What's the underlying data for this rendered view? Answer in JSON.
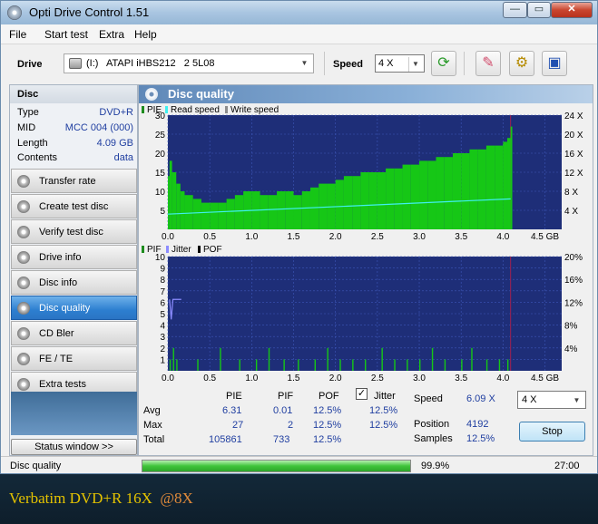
{
  "window": {
    "title": "Opti Drive Control 1.51",
    "min": "—",
    "max": "▭",
    "close": "✕"
  },
  "menu": [
    "File",
    "Start test",
    "Extra",
    "Help"
  ],
  "toolbar": {
    "drive_label": "Drive",
    "drive_value": "(I:)   ATAPI iHBS212   2 5L08",
    "speed_label": "Speed",
    "speed_value": "4 X",
    "icons": [
      "refresh-icon",
      "eraser-icon",
      "settings-icon",
      "save-icon"
    ]
  },
  "disc_info": {
    "header": "Disc",
    "rows": [
      {
        "key": "Type",
        "value": "DVD+R"
      },
      {
        "key": "MID",
        "value": "MCC 004 (000)"
      },
      {
        "key": "Length",
        "value": "4.09 GB"
      },
      {
        "key": "Contents",
        "value": "data"
      }
    ]
  },
  "nav": [
    {
      "label": "Transfer rate",
      "active": false
    },
    {
      "label": "Create test disc",
      "active": false
    },
    {
      "label": "Verify test disc",
      "active": false
    },
    {
      "label": "Drive info",
      "active": false
    },
    {
      "label": "Disc info",
      "active": false
    },
    {
      "label": "Disc quality",
      "active": true
    },
    {
      "label": "CD Bler",
      "active": false
    },
    {
      "label": "FE / TE",
      "active": false
    },
    {
      "label": "Extra tests",
      "active": false
    }
  ],
  "status_window_button": "Status window >>",
  "main": {
    "title": "Disc quality"
  },
  "chart_data": [
    {
      "type": "area",
      "legend": [
        {
          "name": "PIE",
          "color": "#1e8c1e"
        },
        {
          "name": "Read speed",
          "color": "#3ff0f0"
        },
        {
          "name": "Write speed",
          "color": "#8c8c8c"
        }
      ],
      "x_ticks": [
        "0.0",
        "0.5",
        "1.0",
        "1.5",
        "2.0",
        "2.5",
        "3.0",
        "3.5",
        "4.0",
        "4.5 GB"
      ],
      "y_ticks": [
        "30",
        "25",
        "20",
        "15",
        "10",
        "5"
      ],
      "y2_ticks": [
        "24 X",
        "20 X",
        "16 X",
        "12 X",
        "8 X",
        "4 X"
      ],
      "xlim": [
        0,
        4.7
      ],
      "ylim": [
        0,
        30
      ],
      "y2lim": [
        0,
        24
      ],
      "background": "#1e2e78",
      "grid": true,
      "series": [
        {
          "name": "PIE",
          "x": [
            0.0,
            0.02,
            0.05,
            0.1,
            0.15,
            0.2,
            0.3,
            0.4,
            0.5,
            0.6,
            0.7,
            0.8,
            0.9,
            1.0,
            1.1,
            1.2,
            1.3,
            1.4,
            1.5,
            1.6,
            1.7,
            1.8,
            1.9,
            2.0,
            2.1,
            2.2,
            2.3,
            2.4,
            2.5,
            2.6,
            2.7,
            2.8,
            2.9,
            3.0,
            3.1,
            3.2,
            3.3,
            3.4,
            3.5,
            3.6,
            3.7,
            3.8,
            3.9,
            4.0,
            4.05,
            4.09
          ],
          "values": [
            14,
            18,
            15,
            12,
            10,
            9,
            8,
            7,
            7,
            7,
            8,
            9,
            10,
            10,
            9,
            9,
            10,
            10,
            9,
            10,
            11,
            12,
            12,
            13,
            14,
            14,
            15,
            15,
            15,
            16,
            16,
            17,
            17,
            18,
            18,
            19,
            19,
            20,
            20,
            21,
            21,
            22,
            22,
            23,
            24,
            27
          ]
        },
        {
          "name": "Read speed",
          "x": [
            0.0,
            4.09
          ],
          "values": [
            3.2,
            6.4
          ]
        }
      ]
    },
    {
      "type": "bar",
      "legend": [
        {
          "name": "PIF",
          "color": "#1e8c1e"
        },
        {
          "name": "Jitter",
          "color": "#8c8cff"
        },
        {
          "name": "POF",
          "color": "#000000"
        }
      ],
      "x_ticks": [
        "0.0",
        "0.5",
        "1.0",
        "1.5",
        "2.0",
        "2.5",
        "3.0",
        "3.5",
        "4.0",
        "4.5 GB"
      ],
      "y_ticks": [
        "10",
        "9",
        "8",
        "7",
        "6",
        "5",
        "4",
        "3",
        "2",
        "1"
      ],
      "y2_ticks": [
        "20%",
        "16%",
        "12%",
        "8%",
        "4%"
      ],
      "xlim": [
        0,
        4.7
      ],
      "ylim": [
        0,
        10
      ],
      "y2lim": [
        0,
        20
      ],
      "background": "#1e2e78",
      "grid": true,
      "series": [
        {
          "name": "PIF",
          "x": [
            0.02,
            0.06,
            0.1,
            0.35,
            0.62,
            0.85,
            1.05,
            1.2,
            1.38,
            1.55,
            1.75,
            1.9,
            2.05,
            2.2,
            2.35,
            2.55,
            2.7,
            2.85,
            3.0,
            3.15,
            3.3,
            3.5,
            3.62,
            3.8,
            3.95,
            4.05
          ],
          "values": [
            1,
            2,
            1,
            1,
            2,
            1,
            1,
            2,
            1,
            1,
            1,
            2,
            1,
            1,
            1,
            2,
            1,
            1,
            1,
            2,
            1,
            1,
            2,
            1,
            1,
            1
          ]
        },
        {
          "name": "Jitter",
          "x": [
            0.02,
            0.04,
            0.06,
            0.1,
            0.16
          ],
          "values": [
            12.5,
            9,
            12.5,
            12.5,
            12.5
          ]
        }
      ]
    }
  ],
  "stats": {
    "headers": {
      "pie": "PIE",
      "pif": "PIF",
      "pof": "POF",
      "jitter": "Jitter"
    },
    "jitter_checked": "✓",
    "rows": [
      {
        "label": "Avg",
        "pie": "6.31",
        "pif": "0.01",
        "pof": "12.5%",
        "jitter": "12.5%"
      },
      {
        "label": "Max",
        "pie": "27",
        "pif": "2",
        "pof": "12.5%",
        "jitter": "12.5%"
      },
      {
        "label": "Total",
        "pie": "105861",
        "pif": "733",
        "pof": "12.5%"
      }
    ],
    "speed_label": "Speed",
    "speed_value": "6.09 X",
    "position_label": "Position",
    "position_value": "4192",
    "samples_label": "Samples",
    "samples_value": "12.5%",
    "speed_select": "4 X",
    "stop_button": "Stop"
  },
  "statusbar": {
    "text": "Disc quality",
    "progress": 99.9,
    "progress_text": "99.9%",
    "time": "27:00"
  },
  "caption": {
    "text": "Verbatim DVD+R 16X  ",
    "speed": "@8X"
  }
}
